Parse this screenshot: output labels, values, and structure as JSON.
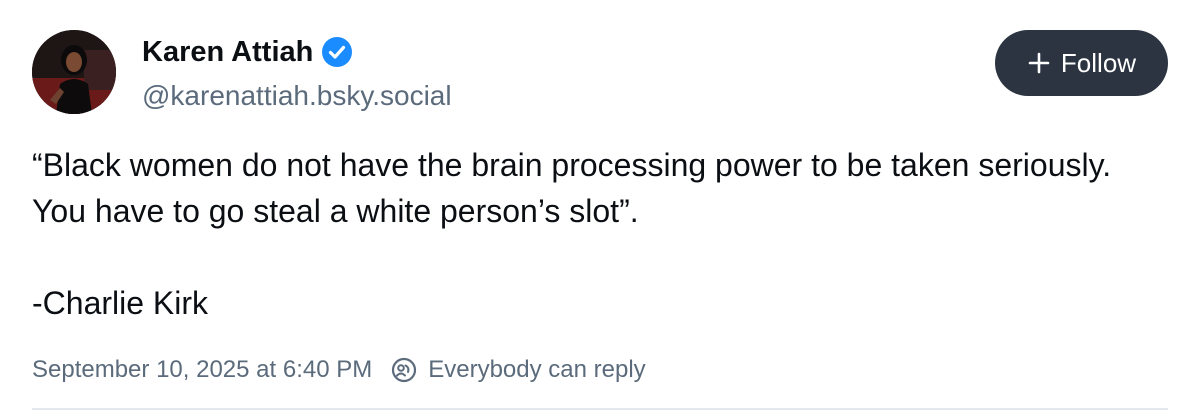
{
  "author": {
    "display_name": "Karen Attiah",
    "handle": "@karenattiah.bsky.social",
    "verified": true
  },
  "follow_button": {
    "label": "Follow"
  },
  "post": {
    "quote": "“Black women do not have the brain processing power to be taken seriously. You have to go steal a white person’s slot”.",
    "attribution": "-Charlie Kirk"
  },
  "meta": {
    "timestamp": "September 10, 2025 at 6:40 PM",
    "reply_setting": "Everybody can reply"
  },
  "icons": {
    "verified": "verified-check-icon",
    "follow": "plus-icon",
    "reply": "reply-permission-icon"
  },
  "colors": {
    "text": "#0b0f14",
    "secondary_text": "#5b6b7c",
    "button_bg": "#2b3440",
    "verified_blue": "#1a8cff",
    "divider": "#e3e8ee"
  }
}
